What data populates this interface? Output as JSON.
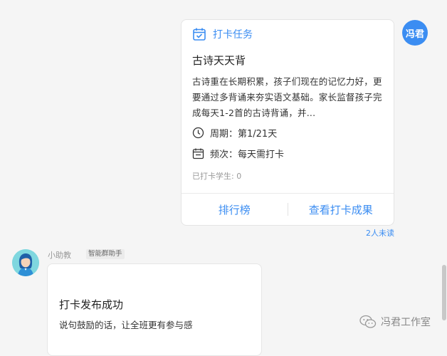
{
  "sender": {
    "avatar_text": "冯君"
  },
  "task_card": {
    "tag": "打卡任务",
    "title": "古诗天天背",
    "description": "古诗重在长期积累，孩子们现在的记忆力好，更要通过多背诵来夯实语文基础。家长监督孩子完成每天1-2首的古诗背诵，并...",
    "cycle": "周期：第1/21天",
    "frequency": "频次：每天需打卡",
    "checked_in": "已打卡学生: 0",
    "buttons": {
      "leaderboard": "排行榜",
      "view_results": "查看打卡成果"
    }
  },
  "read_status": "2人未读",
  "assistant": {
    "name": "小助教",
    "badge": "智能群助手",
    "message_title": "打卡发布成功",
    "message_sub": "说句鼓励的话，让全班更有参与感"
  },
  "watermark": {
    "text": "冯君工作室"
  },
  "colors": {
    "accent": "#3b8df2",
    "background": "#f5f5f5"
  }
}
